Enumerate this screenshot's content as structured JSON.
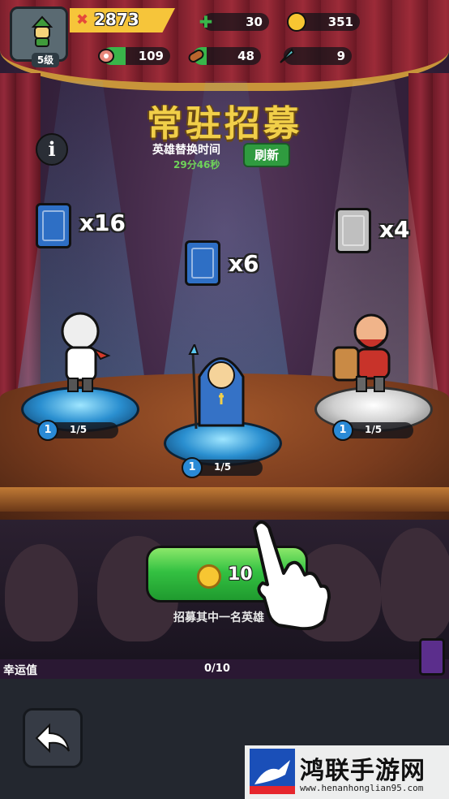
{
  "player": {
    "level_label": "5级",
    "power": "2873",
    "avatar_icon": "knight-avatar-icon"
  },
  "resources": [
    {
      "name": "stamina",
      "icon": "green-cross-icon",
      "value": "30",
      "color": "#39b54a"
    },
    {
      "name": "gold",
      "icon": "coin-icon",
      "value": "351",
      "color": "#f7c632"
    },
    {
      "name": "meat",
      "icon": "meat-icon",
      "value": "109",
      "color": "#39b54a"
    },
    {
      "name": "wood",
      "icon": "log-icon",
      "value": "48",
      "color": "#39b54a"
    },
    {
      "name": "crystal",
      "icon": "feather-icon",
      "value": "9",
      "color": "#39b54a"
    }
  ],
  "resource_fill": {
    "stamina": 0.0,
    "gold": 0.0,
    "meat": 0.35,
    "wood": 0.2,
    "crystal": 0.0
  },
  "banner": {
    "title": "常驻招募",
    "subtitle": "英雄替换时间",
    "timer": "29分46秒",
    "refresh_label": "刷新",
    "info_label": "i"
  },
  "heroes": [
    {
      "name": "white-haired-warrior",
      "card_color": "blue",
      "card_count": "x16",
      "level": "1",
      "progress": "1/5"
    },
    {
      "name": "hooded-priest",
      "card_color": "blue",
      "card_count": "x6",
      "level": "1",
      "progress": "1/5"
    },
    {
      "name": "shield-bearer",
      "card_color": "white",
      "card_count": "x4",
      "level": "1",
      "progress": "1/5"
    }
  ],
  "recruit": {
    "cost": "10",
    "hint": "招募其中一名英雄"
  },
  "luck": {
    "label": "幸运值",
    "value": "0/10",
    "fraction": 0.0
  },
  "watermark": {
    "title": "鸿联手游网",
    "url": "www.henanhonglian95.com"
  },
  "colors": {
    "title_gold": "#f1cf49",
    "button_green": "#34c142",
    "blue_rarity": "#2e6fc5",
    "luck_purple": "#5b2e8c"
  }
}
